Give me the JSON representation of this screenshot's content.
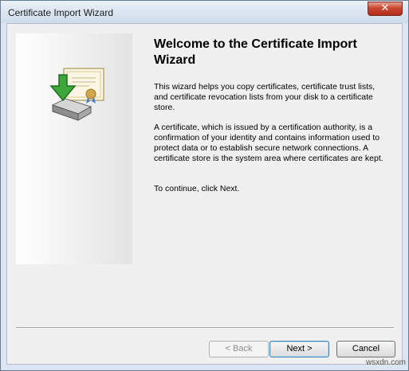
{
  "window": {
    "title": "Certificate Import Wizard",
    "close_glyph": "✕"
  },
  "side_panel": {
    "icon": "certificate-import-icon"
  },
  "content": {
    "heading": "Welcome to the Certificate Import Wizard",
    "paragraphs": [
      "This wizard helps you copy certificates, certificate trust lists, and certificate revocation lists from your disk to a certificate store.",
      "A certificate, which is issued by a certification authority, is a confirmation of your identity and contains information used to protect data or to establish secure network connections. A certificate store is the system area where certificates are kept.",
      "To continue, click Next."
    ]
  },
  "buttons": {
    "back": "< Back",
    "next": "Next >",
    "cancel": "Cancel"
  },
  "watermark": "wsxdn.com",
  "colors": {
    "accent": "#3c7fb1",
    "close": "#c9472f"
  }
}
